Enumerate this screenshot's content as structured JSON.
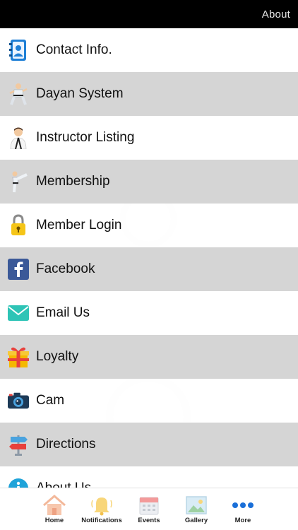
{
  "header": {
    "title": "About"
  },
  "menu": {
    "items": [
      {
        "label": "Contact Info.",
        "icon": "contact-book-icon"
      },
      {
        "label": "Dayan System",
        "icon": "karate-figure-icon"
      },
      {
        "label": "Instructor Listing",
        "icon": "instructor-icon"
      },
      {
        "label": "Membership",
        "icon": "kick-figure-icon"
      },
      {
        "label": "Member Login",
        "icon": "padlock-icon"
      },
      {
        "label": "Facebook",
        "icon": "facebook-icon"
      },
      {
        "label": "Email Us",
        "icon": "envelope-icon"
      },
      {
        "label": "Loyalty",
        "icon": "gift-icon"
      },
      {
        "label": "Cam",
        "icon": "camera-icon"
      },
      {
        "label": "Directions",
        "icon": "signpost-icon"
      },
      {
        "label": "About Us",
        "icon": "info-icon"
      }
    ]
  },
  "tabbar": {
    "tabs": [
      {
        "label": "Home",
        "icon": "home-icon"
      },
      {
        "label": "Notifications",
        "icon": "bell-icon"
      },
      {
        "label": "Events",
        "icon": "calendar-icon"
      },
      {
        "label": "Gallery",
        "icon": "gallery-icon"
      },
      {
        "label": "More",
        "icon": "more-dots-icon"
      }
    ]
  },
  "colors": {
    "topbar": "#000000",
    "more_accent": "#1a6fd8",
    "facebook": "#3b5998",
    "email": "#2ec4b6"
  }
}
